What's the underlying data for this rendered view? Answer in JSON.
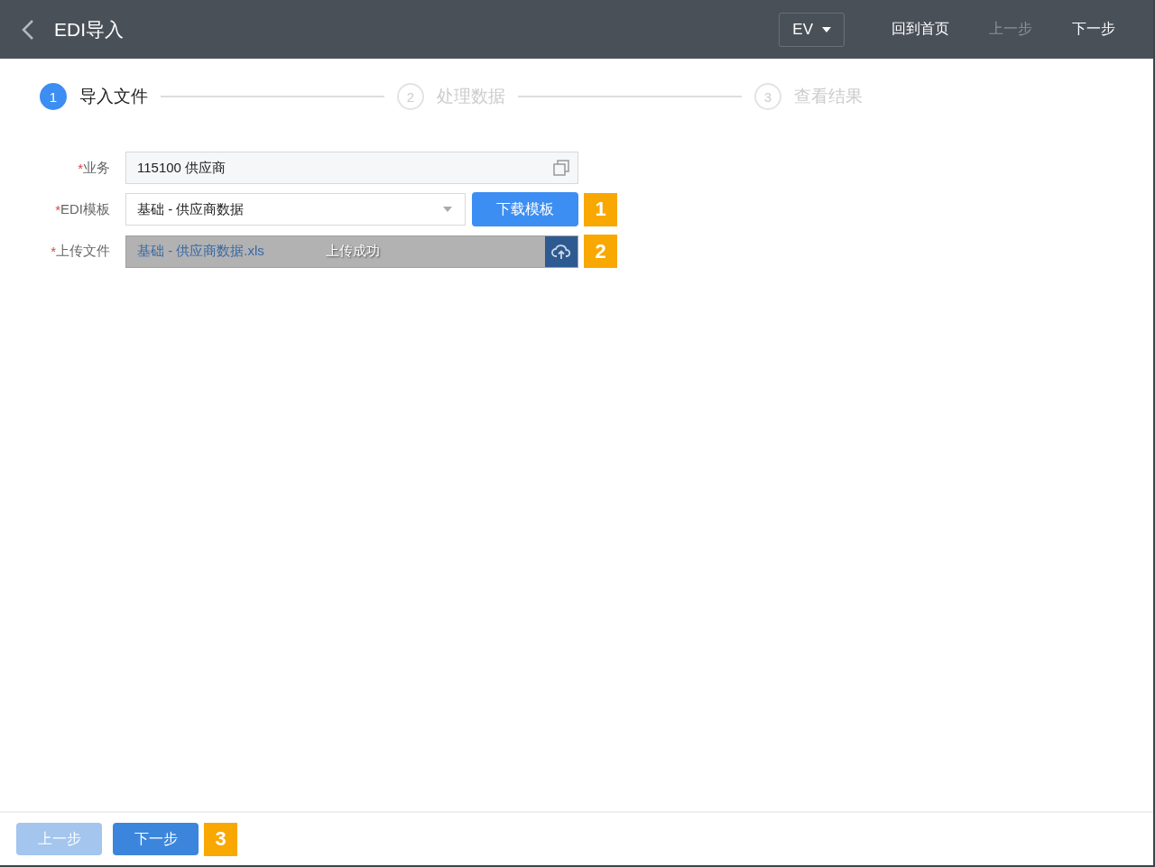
{
  "header": {
    "title": "EDI导入",
    "selector": "EV",
    "links": [
      {
        "label": "回到首页",
        "disabled": false
      },
      {
        "label": "上一步",
        "disabled": true
      },
      {
        "label": "下一步",
        "disabled": false
      }
    ]
  },
  "steps": [
    {
      "number": "1",
      "label": "导入文件",
      "selected": true
    },
    {
      "number": "2",
      "label": "处理数据",
      "selected": false
    },
    {
      "number": "3",
      "label": "查看结果",
      "selected": false
    }
  ],
  "form": [
    {
      "kind": "lookup",
      "mark": "*",
      "label": "业务",
      "value": "115100 供应商"
    },
    {
      "kind": "select",
      "mark": "*",
      "label": "EDI模板",
      "value": "基础 - 供应商数据",
      "button": "下载模板",
      "badge": "1"
    },
    {
      "kind": "upload",
      "mark": "*",
      "label": "上传文件",
      "value": "基础 - 供应商数据.xls",
      "status": "上传成功",
      "badge": "2"
    }
  ],
  "footer": {
    "buttons": [
      {
        "label": "上一步",
        "disabled": true
      },
      {
        "label": "下一步",
        "disabled": false
      }
    ],
    "badge": "3"
  }
}
